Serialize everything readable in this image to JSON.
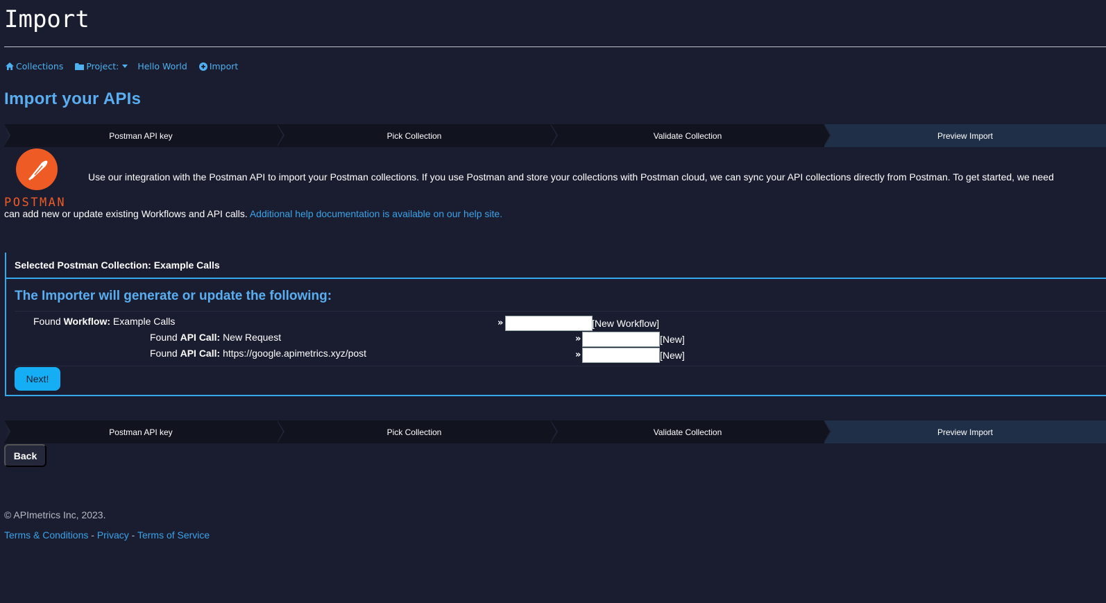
{
  "header": {
    "title": "Import"
  },
  "breadcrumb": {
    "collections": "Collections",
    "project": "Project:",
    "project_name": "Hello World",
    "import": "Import"
  },
  "page_heading": "Import your APIs",
  "steps": [
    "Postman API key",
    "Pick Collection",
    "Validate Collection",
    "Preview Import"
  ],
  "active_step": "Preview Import",
  "logo": {
    "wordmark": "POSTMAN",
    "color": "#ef5b25"
  },
  "intro": {
    "line1": "Use our integration with the Postman API to import your Postman collections. If you use Postman and store your collections with Postman cloud, we can sync your API collections directly from Postman. To get started, we need",
    "line2": "can add new or update existing Workflows and API calls.",
    "help_link": "Additional help documentation is available on our help site."
  },
  "panel": {
    "header": "Selected Postman Collection: Example Calls",
    "subtitle": "The Importer will generate or update the following:",
    "workflow": {
      "prefix": "Found",
      "kind": "Workflow:",
      "name": "Example Calls",
      "tag": "[New Workflow]",
      "input_value": ""
    },
    "calls": [
      {
        "prefix": "Found",
        "kind": "API Call:",
        "name": "New Request",
        "tag": "[New]",
        "input_value": ""
      },
      {
        "prefix": "Found",
        "kind": "API Call:",
        "name": "https://google.apimetrics.xyz/post",
        "tag": "[New]",
        "input_value": ""
      }
    ],
    "arrow": "»",
    "next_label": "Next!"
  },
  "back_label": "Back",
  "footer": {
    "copyright": "© APImetrics Inc, 2023.",
    "terms": "Terms & Conditions",
    "privacy": "Privacy",
    "tos": "Terms of Service",
    "sep": " - "
  },
  "colors": {
    "accent": "#35a9ee",
    "background": "#1a1d30",
    "button": "#15aef4"
  }
}
